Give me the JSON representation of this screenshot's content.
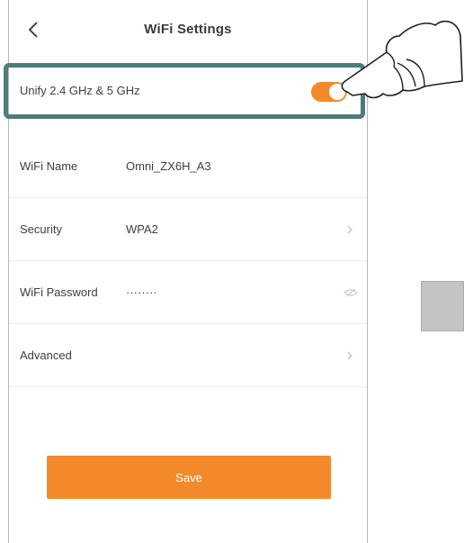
{
  "header": {
    "title": "WiFi Settings"
  },
  "unify": {
    "label": "Unify 2.4 GHz & 5 GHz",
    "enabled": true
  },
  "fields": [
    {
      "label": "WiFi Name",
      "value": "Omni_ZX6H_A3"
    },
    {
      "label": "Security",
      "value": "WPA2"
    },
    {
      "label": "WiFi Password",
      "value": "········"
    },
    {
      "label": "Advanced",
      "value": ""
    }
  ],
  "save": {
    "label": "Save"
  },
  "colors": {
    "accent": "#f28a2c",
    "highlight": "#4d7d78"
  },
  "icons": [
    "back-arrow-icon",
    "chevron-right-icon",
    "eye-icon",
    "pointing-hand-icon"
  ]
}
